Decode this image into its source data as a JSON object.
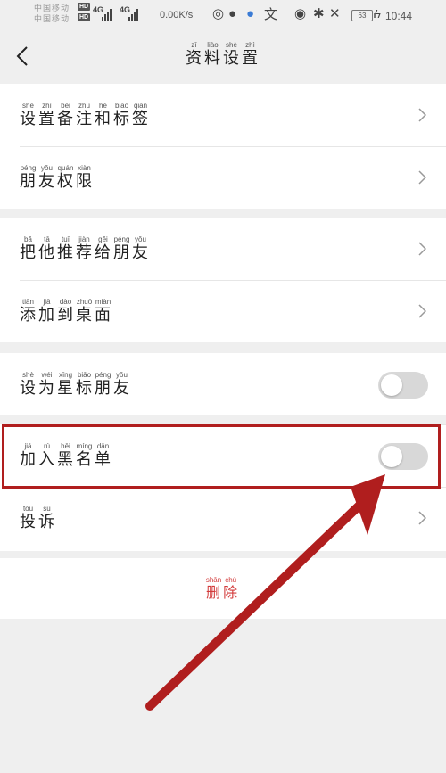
{
  "status_bar": {
    "carrier_lines": [
      "中国移动",
      "中国移动"
    ],
    "hd_label": "HD",
    "network_labels": [
      "4G",
      "4G"
    ],
    "net_speed": "0.00K/s",
    "battery_level": "63",
    "time": "10:44"
  },
  "header": {
    "title": [
      {
        "char": "资",
        "py": "zī"
      },
      {
        "char": "料",
        "py": "liào"
      },
      {
        "char": "设",
        "py": "shè"
      },
      {
        "char": "置",
        "py": "zhì"
      }
    ]
  },
  "groups": [
    {
      "rows": [
        {
          "name": "set-remark-tags",
          "control": "chevron",
          "label": [
            {
              "char": "设",
              "py": "shè"
            },
            {
              "char": "置",
              "py": "zhì"
            },
            {
              "char": "备",
              "py": "bèi"
            },
            {
              "char": "注",
              "py": "zhù"
            },
            {
              "char": "和",
              "py": "hé"
            },
            {
              "char": "标",
              "py": "biāo"
            },
            {
              "char": "签",
              "py": "qiān"
            }
          ]
        },
        {
          "name": "friend-permissions",
          "control": "chevron",
          "label": [
            {
              "char": "朋",
              "py": "péng"
            },
            {
              "char": "友",
              "py": "yǒu"
            },
            {
              "char": "权",
              "py": "quán"
            },
            {
              "char": "限",
              "py": "xiàn"
            }
          ]
        }
      ]
    },
    {
      "rows": [
        {
          "name": "recommend-to-friend",
          "control": "chevron",
          "label": [
            {
              "char": "把",
              "py": "bǎ"
            },
            {
              "char": "他",
              "py": "tā"
            },
            {
              "char": "推",
              "py": "tuī"
            },
            {
              "char": "荐",
              "py": "jiàn"
            },
            {
              "char": "给",
              "py": "gěi"
            },
            {
              "char": "朋",
              "py": "péng"
            },
            {
              "char": "友",
              "py": "yǒu"
            }
          ]
        },
        {
          "name": "add-to-desktop",
          "control": "chevron",
          "label": [
            {
              "char": "添",
              "py": "tiān"
            },
            {
              "char": "加",
              "py": "jiā"
            },
            {
              "char": "到",
              "py": "dào"
            },
            {
              "char": "桌",
              "py": "zhuō"
            },
            {
              "char": "面",
              "py": "miàn"
            }
          ]
        }
      ]
    },
    {
      "rows": [
        {
          "name": "star-friend",
          "control": "toggle",
          "toggle_on": false,
          "label": [
            {
              "char": "设",
              "py": "shè"
            },
            {
              "char": "为",
              "py": "wéi"
            },
            {
              "char": "星",
              "py": "xīng"
            },
            {
              "char": "标",
              "py": "biāo"
            },
            {
              "char": "朋",
              "py": "péng"
            },
            {
              "char": "友",
              "py": "yǒu"
            }
          ]
        },
        {
          "name": "add-to-blacklist",
          "control": "toggle",
          "toggle_on": false,
          "label": [
            {
              "char": "加",
              "py": "jiā"
            },
            {
              "char": "入",
              "py": "rù"
            },
            {
              "char": "黑",
              "py": "hēi"
            },
            {
              "char": "名",
              "py": "míng"
            },
            {
              "char": "单",
              "py": "dān"
            }
          ]
        },
        {
          "name": "complain",
          "control": "chevron",
          "label": [
            {
              "char": "投",
              "py": "tóu"
            },
            {
              "char": "诉",
              "py": "sù"
            }
          ]
        }
      ]
    }
  ],
  "delete": {
    "label": [
      {
        "char": "删",
        "py": "shān"
      },
      {
        "char": "除",
        "py": "chú"
      }
    ]
  },
  "colors": {
    "background": "#efefef",
    "delete_text": "#d23a3a",
    "annotation": "#b01e1e",
    "toggle_off": "#d8d8d8"
  }
}
